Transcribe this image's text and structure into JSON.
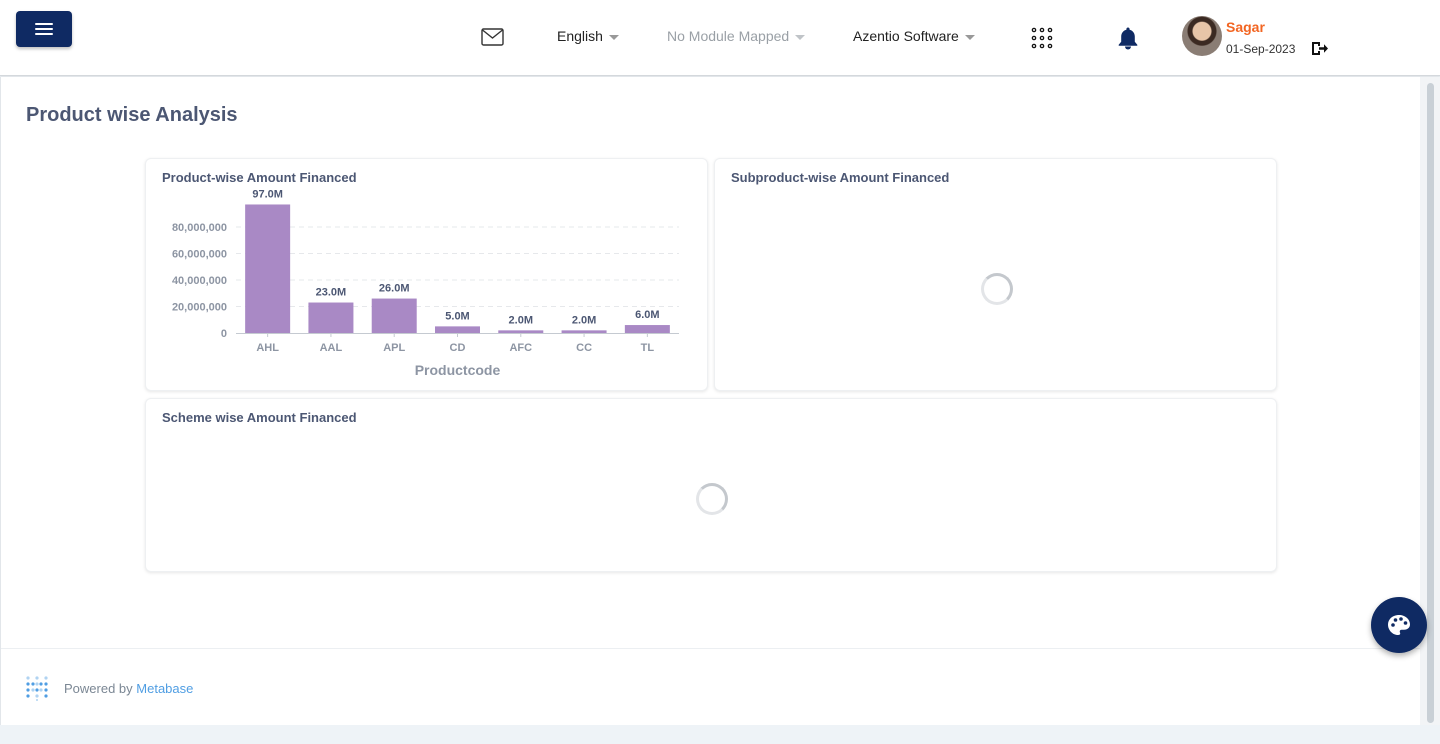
{
  "header": {
    "language": "English",
    "module": "No Module Mapped",
    "company": "Azentio Software",
    "user": {
      "name": "Sagar",
      "date": "01-Sep-2023"
    }
  },
  "page": {
    "title": "Product wise Analysis"
  },
  "cards": {
    "product": {
      "title": "Product-wise Amount Financed"
    },
    "subproduct": {
      "title": "Subproduct-wise Amount Financed"
    },
    "scheme": {
      "title": "Scheme wise Amount Financed"
    }
  },
  "footer": {
    "powered_by": "Powered by",
    "brand": "Metabase"
  },
  "colors": {
    "bar": "#a989c5",
    "primary": "#0f2a63",
    "accent": "#f26522",
    "link": "#509ee3"
  },
  "chart_data": {
    "type": "bar",
    "title": "Product-wise Amount Financed",
    "xlabel": "Productcode",
    "ylabel": "",
    "categories": [
      "AHL",
      "AAL",
      "APL",
      "CD",
      "AFC",
      "CC",
      "TL"
    ],
    "values": [
      97000000,
      23000000,
      26000000,
      5000000,
      2000000,
      2000000,
      6000000
    ],
    "data_labels": [
      "97.0M",
      "23.0M",
      "26.0M",
      "5.0M",
      "2.0M",
      "2.0M",
      "6.0M"
    ],
    "y_ticks": [
      0,
      20000000,
      40000000,
      60000000,
      80000000
    ],
    "y_tick_labels": [
      "0",
      "20,000,000",
      "40,000,000",
      "60,000,000",
      "80,000,000"
    ],
    "ylim": [
      0,
      100000000
    ],
    "grid": true
  }
}
